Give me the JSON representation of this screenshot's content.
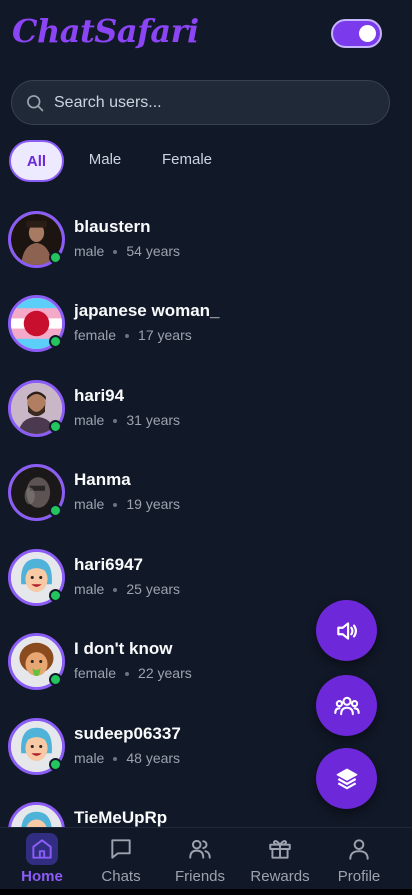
{
  "app": {
    "logo": "ChatSafari"
  },
  "header": {
    "theme_toggle_on": true
  },
  "search": {
    "placeholder": "Search users..."
  },
  "filters": [
    {
      "label": "All",
      "active": true
    },
    {
      "label": "Male",
      "active": false
    },
    {
      "label": "Female",
      "active": false
    }
  ],
  "users": [
    {
      "name": "blaustern",
      "gender": "male",
      "age": "54 years",
      "avatar": "photo-dark-portrait"
    },
    {
      "name": "japanese woman_",
      "gender": "female",
      "age": "17 years",
      "avatar": "japan-flag-circle"
    },
    {
      "name": "hari94",
      "gender": "male",
      "age": "31 years",
      "avatar": "photo-bearded-man"
    },
    {
      "name": "Hanma",
      "gender": "male",
      "age": "19 years",
      "avatar": "photo-dark-blurred"
    },
    {
      "name": "hari6947",
      "gender": "male",
      "age": "25 years",
      "avatar": "cartoon-blue-hair"
    },
    {
      "name": "I don't know",
      "gender": "female",
      "age": "22 years",
      "avatar": "cartoon-curly-tongue"
    },
    {
      "name": "sudeep06337",
      "gender": "male",
      "age": "48 years",
      "avatar": "cartoon-blue-hair"
    },
    {
      "name": "TieMeUpRp",
      "gender": "",
      "age": "",
      "avatar": "cartoon-blue-hair"
    }
  ],
  "fabs": [
    {
      "icon": "speaker-icon"
    },
    {
      "icon": "group-icon"
    },
    {
      "icon": "layers-icon"
    }
  ],
  "nav": [
    {
      "label": "Home",
      "icon": "home-icon",
      "active": true
    },
    {
      "label": "Chats",
      "icon": "chat-icon",
      "active": false
    },
    {
      "label": "Friends",
      "icon": "friends-icon",
      "active": false
    },
    {
      "label": "Rewards",
      "icon": "gift-icon",
      "active": false
    },
    {
      "label": "Profile",
      "icon": "person-icon",
      "active": false
    }
  ],
  "colors": {
    "accent": "#7c3aed",
    "background": "#111827",
    "online": "#22c55e"
  }
}
